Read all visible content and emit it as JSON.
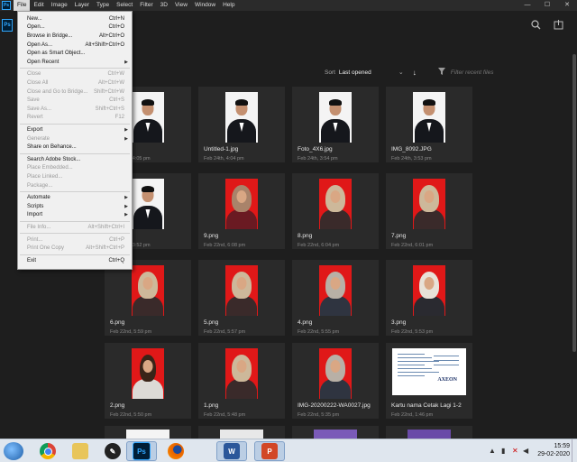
{
  "app": {
    "logo_text": "Ps",
    "menus": [
      "File",
      "Edit",
      "Image",
      "Layer",
      "Type",
      "Select",
      "Filter",
      "3D",
      "View",
      "Window",
      "Help"
    ],
    "active_menu": "File",
    "window_controls": {
      "minimize": "—",
      "maximize": "☐",
      "close": "✕"
    }
  },
  "toolbar": {
    "search_icon": "search-icon",
    "share_icon": "share-icon"
  },
  "sort": {
    "label": "Sort",
    "value": "Last opened",
    "filter_placeholder": "Filter recent files"
  },
  "file_menu": {
    "items": [
      {
        "label": "New...",
        "shortcut": "Ctrl+N",
        "enabled": true
      },
      {
        "label": "Open...",
        "shortcut": "Ctrl+O",
        "enabled": true
      },
      {
        "label": "Browse in Bridge...",
        "shortcut": "Alt+Ctrl+O",
        "enabled": true
      },
      {
        "label": "Open As...",
        "shortcut": "Alt+Shift+Ctrl+O",
        "enabled": true
      },
      {
        "label": "Open as Smart Object...",
        "shortcut": "",
        "enabled": true
      },
      {
        "label": "Open Recent",
        "shortcut": "",
        "enabled": true,
        "submenu": true
      },
      {
        "separator": true
      },
      {
        "label": "Close",
        "shortcut": "Ctrl+W",
        "enabled": false
      },
      {
        "label": "Close All",
        "shortcut": "Alt+Ctrl+W",
        "enabled": false
      },
      {
        "label": "Close and Go to Bridge...",
        "shortcut": "Shift+Ctrl+W",
        "enabled": false
      },
      {
        "label": "Save",
        "shortcut": "Ctrl+S",
        "enabled": false
      },
      {
        "label": "Save As...",
        "shortcut": "Shift+Ctrl+S",
        "enabled": false
      },
      {
        "label": "Revert",
        "shortcut": "F12",
        "enabled": false
      },
      {
        "separator": true
      },
      {
        "label": "Export",
        "shortcut": "",
        "enabled": true,
        "submenu": true
      },
      {
        "label": "Generate",
        "shortcut": "",
        "enabled": false,
        "submenu": true
      },
      {
        "label": "Share on Behance...",
        "shortcut": "",
        "enabled": true
      },
      {
        "separator": true
      },
      {
        "label": "Search Adobe Stock...",
        "shortcut": "",
        "enabled": true
      },
      {
        "label": "Place Embedded...",
        "shortcut": "",
        "enabled": false
      },
      {
        "label": "Place Linked...",
        "shortcut": "",
        "enabled": false
      },
      {
        "label": "Package...",
        "shortcut": "",
        "enabled": false
      },
      {
        "separator": true
      },
      {
        "label": "Automate",
        "shortcut": "",
        "enabled": true,
        "submenu": true
      },
      {
        "label": "Scripts",
        "shortcut": "",
        "enabled": true,
        "submenu": true
      },
      {
        "label": "Import",
        "shortcut": "",
        "enabled": true,
        "submenu": true
      },
      {
        "separator": true
      },
      {
        "label": "File Info...",
        "shortcut": "Alt+Shift+Ctrl+I",
        "enabled": false
      },
      {
        "separator": true
      },
      {
        "label": "Print...",
        "shortcut": "Ctrl+P",
        "enabled": false
      },
      {
        "label": "Print One Copy",
        "shortcut": "Alt+Shift+Ctrl+P",
        "enabled": false
      },
      {
        "separator": true
      },
      {
        "label": "Exit",
        "shortcut": "Ctrl+Q",
        "enabled": true
      }
    ]
  },
  "recent_files": [
    {
      "name": "",
      "date": "Feb 24th, 4:05 pm",
      "thumb": "man-white"
    },
    {
      "name": "Untitled-1.jpg",
      "date": "Feb 24th, 4:04 pm",
      "thumb": "man-white"
    },
    {
      "name": "Foto_4X6.jpg",
      "date": "Feb 24th, 3:54 pm",
      "thumb": "man-white"
    },
    {
      "name": "IMG_8092.JPG",
      "date": "Feb 24th, 3:53 pm",
      "thumb": "man-white"
    },
    {
      "name": "",
      "date": "Feb 24th, 3:52 pm",
      "thumb": "man-white"
    },
    {
      "name": "9.png",
      "date": "Feb 22nd, 6:08 pm",
      "thumb": "woman-red-maroon"
    },
    {
      "name": "8.png",
      "date": "Feb 22nd, 6:04 pm",
      "thumb": "woman-red-beige"
    },
    {
      "name": "7.png",
      "date": "Feb 22nd, 6:01 pm",
      "thumb": "woman-red-beige"
    },
    {
      "name": "6.png",
      "date": "Feb 22nd, 5:59 pm",
      "thumb": "woman-red-beige"
    },
    {
      "name": "5.png",
      "date": "Feb 22nd, 5:57 pm",
      "thumb": "woman-red-beige"
    },
    {
      "name": "4.png",
      "date": "Feb 22nd, 5:55 pm",
      "thumb": "woman-red-grey"
    },
    {
      "name": "3.png",
      "date": "Feb 22nd, 5:53 pm",
      "thumb": "woman-red-white"
    },
    {
      "name": "2.png",
      "date": "Feb 22nd, 5:50 pm",
      "thumb": "woman-red-nohijab"
    },
    {
      "name": "1.png",
      "date": "Feb 22nd, 5:48 pm",
      "thumb": "woman-red-beige"
    },
    {
      "name": "IMG-20200222-WA0027.jpg",
      "date": "Feb 22nd, 5:35 pm",
      "thumb": "woman-red-grey"
    },
    {
      "name": "Kartu nama Cetak Lagi 1-2",
      "date": "Feb 22nd, 1:46 pm",
      "thumb": "document"
    }
  ],
  "business_card_logo": "AXEON",
  "taskbar": {
    "apps": [
      {
        "name": "chrome",
        "label": ""
      },
      {
        "name": "file-explorer",
        "label": ""
      },
      {
        "name": "inkscape",
        "label": ""
      },
      {
        "name": "photoshop",
        "label": "Ps"
      },
      {
        "name": "firefox",
        "label": ""
      },
      {
        "name": "word",
        "label": "W"
      },
      {
        "name": "powerpoint",
        "label": "P"
      }
    ],
    "time": "15:59",
    "date": "29-02-2020"
  }
}
